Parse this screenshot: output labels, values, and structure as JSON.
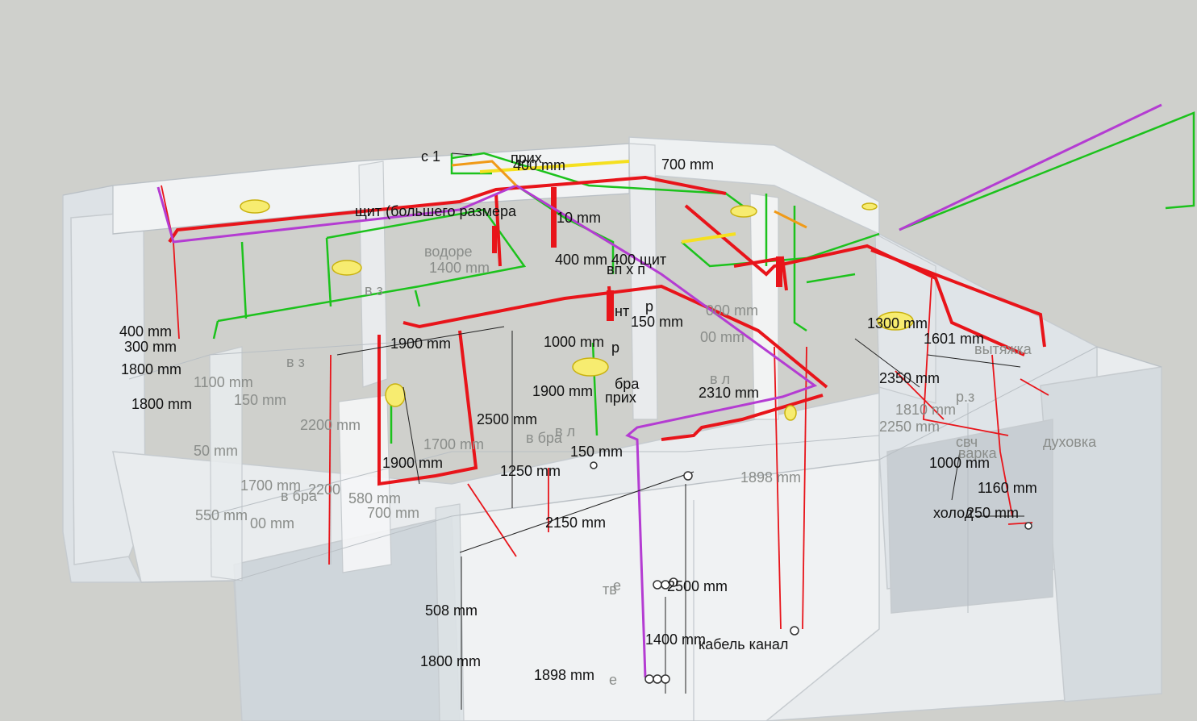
{
  "colors": {
    "background": "#cfd0cc",
    "power_line": "#e8141a",
    "lighting_line": "#1cc21c",
    "data_line": "#b43cd2",
    "aux_line": "#f5e020",
    "orange_line": "#f09a18",
    "fixture": "#f2e23a",
    "wall_glass": "#e4e8ec"
  },
  "labels_dark": [
    {
      "id": "c1",
      "text": "с 1"
    },
    {
      "id": "prih-top",
      "text": "прих"
    },
    {
      "id": "d400-top",
      "text": "400 mm"
    },
    {
      "id": "d700-top",
      "text": "700 mm"
    },
    {
      "id": "shit",
      "text": "щит (большего размера"
    },
    {
      "id": "d10",
      "text": "10 mm"
    },
    {
      "id": "d400-shit",
      "text": "400 mm 400 щит"
    },
    {
      "id": "vp",
      "text": "вп х п"
    },
    {
      "id": "nt",
      "text": "нт"
    },
    {
      "id": "p-top",
      "text": "р"
    },
    {
      "id": "d150a",
      "text": "150 mm"
    },
    {
      "id": "d400-left",
      "text": "400 mm"
    },
    {
      "id": "d300-left",
      "text": "300 mm"
    },
    {
      "id": "d1800-left",
      "text": "1800 mm"
    },
    {
      "id": "d1800-left2",
      "text": "1800 mm"
    },
    {
      "id": "d1900-a",
      "text": "1900 mm"
    },
    {
      "id": "d1000-a",
      "text": "1000 mm"
    },
    {
      "id": "p-mid",
      "text": "р"
    },
    {
      "id": "bra",
      "text": "бра"
    },
    {
      "id": "d1900-b",
      "text": "1900 mm"
    },
    {
      "id": "prih-mid",
      "text": "прих"
    },
    {
      "id": "d2310",
      "text": "2310 mm"
    },
    {
      "id": "d2500-a",
      "text": "2500 mm"
    },
    {
      "id": "d1900-c",
      "text": "1900 mm"
    },
    {
      "id": "d150b",
      "text": "150 mm"
    },
    {
      "id": "d1250",
      "text": "1250 mm"
    },
    {
      "id": "d1300",
      "text": "1300 mm"
    },
    {
      "id": "d1601",
      "text": "1601 mm"
    },
    {
      "id": "d2350",
      "text": "2350 mm"
    },
    {
      "id": "d1000-r",
      "text": "1000 mm"
    },
    {
      "id": "d1160",
      "text": "1160 mm"
    },
    {
      "id": "holod",
      "text": "холод"
    },
    {
      "id": "d250",
      "text": "250 mm"
    },
    {
      "id": "d2150",
      "text": "2150 mm"
    },
    {
      "id": "d2500-b",
      "text": "2500 mm"
    },
    {
      "id": "d508",
      "text": "508 mm"
    },
    {
      "id": "d1400",
      "text": "1400 mm"
    },
    {
      "id": "kabel",
      "text": "кабель канал"
    },
    {
      "id": "d1800-bot",
      "text": "1800 mm"
    },
    {
      "id": "d1898-bot",
      "text": "1898 mm"
    }
  ],
  "labels_faded": [
    {
      "id": "vodo",
      "text": "водоре"
    },
    {
      "id": "d1400-f",
      "text": "1400 mm"
    },
    {
      "id": "v3",
      "text": "в з"
    },
    {
      "id": "v3b",
      "text": "в з"
    },
    {
      "id": "d1100-f",
      "text": "1100 mm"
    },
    {
      "id": "d150-f",
      "text": "150 mm"
    },
    {
      "id": "d2200-f",
      "text": "2200 mm"
    },
    {
      "id": "d50-f",
      "text": "50 mm"
    },
    {
      "id": "vbra1",
      "text": "в бра"
    },
    {
      "id": "vbra2",
      "text": "в бра"
    },
    {
      "id": "d1700-f",
      "text": "1700 mm"
    },
    {
      "id": "d1700-f2",
      "text": "1700 mm"
    },
    {
      "id": "d2200-f2",
      "text": "2200"
    },
    {
      "id": "d580-f",
      "text": "580 mm"
    },
    {
      "id": "d700-f",
      "text": "700 mm"
    },
    {
      "id": "d550-f",
      "text": "550 mm"
    },
    {
      "id": "d00-f",
      "text": "00 mm"
    },
    {
      "id": "vl",
      "text": "в л"
    },
    {
      "id": "vl2",
      "text": "в л"
    },
    {
      "id": "d1898-f",
      "text": "1898 mm"
    },
    {
      "id": "d000-f",
      "text": "000 mm"
    },
    {
      "id": "d00-f2",
      "text": "00 mm"
    },
    {
      "id": "vytyazhka",
      "text": "вытяжка"
    },
    {
      "id": "d1810-f",
      "text": "1810 mm"
    },
    {
      "id": "d2250-f",
      "text": "2250 mm"
    },
    {
      "id": "svch",
      "text": "свч"
    },
    {
      "id": "duhovka",
      "text": "духовка"
    },
    {
      "id": "varka",
      "text": "варка"
    },
    {
      "id": "rz",
      "text": "р.з"
    },
    {
      "id": "tv",
      "text": "тв"
    },
    {
      "id": "e1",
      "text": "е"
    },
    {
      "id": "e2",
      "text": "е"
    }
  ]
}
